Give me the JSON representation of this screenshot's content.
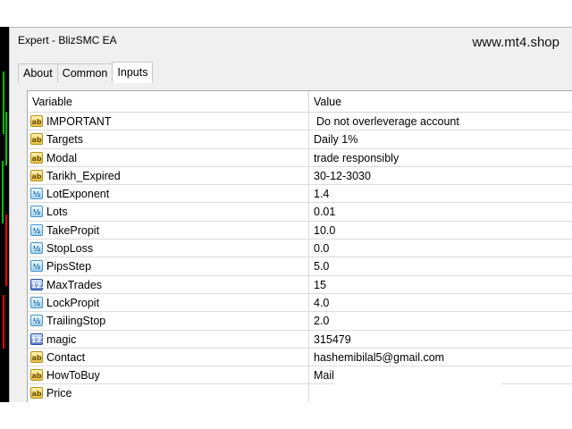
{
  "window": {
    "title": "Expert - BlizSMC EA",
    "watermark": "www.mt4.shop"
  },
  "tabs": [
    {
      "label": "About",
      "active": false
    },
    {
      "label": "Common",
      "active": false
    },
    {
      "label": "Inputs",
      "active": true
    }
  ],
  "grid": {
    "headers": {
      "variable": "Variable",
      "value": "Value"
    },
    "rows": [
      {
        "icon": "text-param-icon",
        "variable": "IMPORTANT",
        "value": "Do not overleverage account"
      },
      {
        "icon": "text-param-icon",
        "variable": "Targets",
        "value": "Daily 1%"
      },
      {
        "icon": "text-param-icon",
        "variable": "Modal",
        "value": "trade responsibly"
      },
      {
        "icon": "text-param-icon",
        "variable": "Tarikh_Expired",
        "value": "30-12-3030"
      },
      {
        "icon": "double-param-icon",
        "variable": "LotExponent",
        "value": "1.4"
      },
      {
        "icon": "double-param-icon",
        "variable": "Lots",
        "value": "0.01"
      },
      {
        "icon": "double-param-icon",
        "variable": "TakePropit",
        "value": "10.0"
      },
      {
        "icon": "double-param-icon",
        "variable": "StopLoss",
        "value": "0.0"
      },
      {
        "icon": "double-param-icon",
        "variable": "PipsStep",
        "value": "5.0"
      },
      {
        "icon": "integer-param-icon",
        "variable": "MaxTrades",
        "value": "15"
      },
      {
        "icon": "double-param-icon",
        "variable": "LockPropit",
        "value": "4.0"
      },
      {
        "icon": "double-param-icon",
        "variable": "TrailingStop",
        "value": "2.0"
      },
      {
        "icon": "integer-param-icon",
        "variable": "magic",
        "value": "315479"
      },
      {
        "icon": "text-param-icon",
        "variable": "Contact",
        "value": "hashemibilal5@gmail.com"
      },
      {
        "icon": "text-param-icon",
        "variable": "HowToBuy",
        "value": "Mail"
      },
      {
        "icon": "text-param-icon",
        "variable": "Price",
        "value": ""
      }
    ]
  },
  "icon_glyphs": {
    "text-param-icon": "ab",
    "double-param-icon": "½",
    "integer-param-icon": "123"
  },
  "colors": {
    "window_bg": "#f0f0f0",
    "grid_border": "#a9a9a9",
    "chart_bg": "#000000",
    "chart_bull": "#00c000",
    "chart_bear": "#ff0000"
  }
}
